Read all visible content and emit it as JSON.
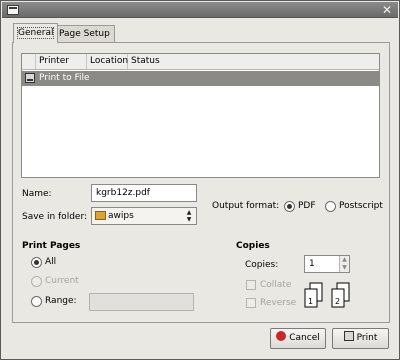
{
  "tabs": [
    {
      "label": "General"
    },
    {
      "label": "Page Setup"
    }
  ],
  "printer_list": {
    "columns": [
      "Printer",
      "Location",
      "Status"
    ],
    "rows": [
      {
        "printer": "Print to File",
        "selected": true
      }
    ]
  },
  "file": {
    "name_label": "Name:",
    "name_value": "kgrb12z.pdf",
    "folder_label": "Save in folder:",
    "folder_value": "awips"
  },
  "output_format": {
    "label": "Output format:",
    "options": [
      "PDF",
      "Postscript"
    ],
    "selected": "PDF"
  },
  "print_pages": {
    "title": "Print Pages",
    "options": [
      "All",
      "Current",
      "Range:"
    ],
    "selected": "All",
    "range_value": ""
  },
  "copies": {
    "title": "Copies",
    "label": "Copies:",
    "value": "1",
    "collate_label": "Collate",
    "reverse_label": "Reverse"
  },
  "buttons": {
    "cancel": "Cancel",
    "print": "Print"
  },
  "icons": {
    "window_menu": "window-menu-icon",
    "close": "close-icon",
    "printer": "printer-icon",
    "folder": "folder-icon",
    "collate": "collate-pages-icon",
    "cancel": "cancel-icon",
    "print": "print-icon"
  }
}
